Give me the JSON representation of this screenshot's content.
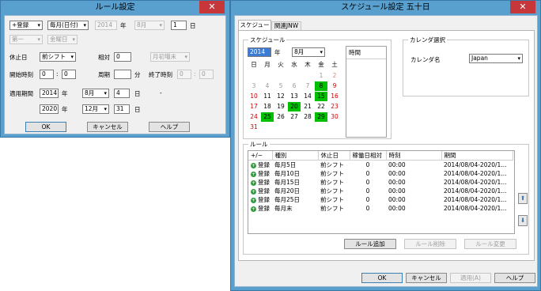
{
  "rule_dialog": {
    "title": "ルール設定",
    "close": "✕",
    "row1": {
      "mode": "+登録",
      "freq": "毎月(日付)",
      "year": "2014",
      "year_label": "年",
      "month": "8月",
      "day": "1",
      "day_label": "日"
    },
    "row2": {
      "week": "第一",
      "weekday": "金曜日"
    },
    "holiday_label": "休止日",
    "holiday": "前シフト",
    "relative_label": "相対",
    "relative": "0",
    "monthend": "月初増末",
    "start_label": "開始時刻",
    "start_h": "0",
    "start_m": "0",
    "cycle_label": "周期",
    "cycle_unit": "分",
    "end_label": "終了時刻",
    "end_h": "0",
    "end_m": "0",
    "period_label": "適用期間",
    "from": {
      "year": "2014",
      "year_label": "年",
      "month": "8月",
      "day": "4",
      "day_label": "日"
    },
    "dash": "-",
    "to": {
      "year": "2020",
      "year_label": "年",
      "month": "12月",
      "day": "31",
      "day_label": "日"
    },
    "ok": "OK",
    "cancel": "キャンセル",
    "help": "ヘルプ"
  },
  "schedule_dialog": {
    "title": "スケジュール設定 五十日",
    "close": "✕",
    "tabs": [
      "スケジュール",
      "関連JNW"
    ],
    "schedule_group": "スケジュール",
    "year": "2014",
    "year_label": "年",
    "month": "8月",
    "weekdays": [
      "日",
      "月",
      "火",
      "水",
      "木",
      "金",
      "土"
    ],
    "time_header": "時間",
    "calendar_group": "カレンダ選択",
    "calendar_name_label": "カレンダ名",
    "calendar_name": "Japan",
    "rule_group": "ルール",
    "rule_columns": [
      "+/−",
      "種別",
      "休止日",
      "稼働日相対",
      "時刻",
      "期間"
    ],
    "rules": [
      {
        "op": "登録",
        "type": "毎月5日",
        "holiday": "前シフト",
        "rel": "0",
        "time": "00:00",
        "period": "2014/08/04-2020/1..."
      },
      {
        "op": "登録",
        "type": "毎月10日",
        "holiday": "前シフト",
        "rel": "0",
        "time": "00:00",
        "period": "2014/08/04-2020/1..."
      },
      {
        "op": "登録",
        "type": "毎月15日",
        "holiday": "前シフト",
        "rel": "0",
        "time": "00:00",
        "period": "2014/08/04-2020/1..."
      },
      {
        "op": "登録",
        "type": "毎月20日",
        "holiday": "前シフト",
        "rel": "0",
        "time": "00:00",
        "period": "2014/08/04-2020/1..."
      },
      {
        "op": "登録",
        "type": "毎月25日",
        "holiday": "前シフト",
        "rel": "0",
        "time": "00:00",
        "period": "2014/08/04-2020/1..."
      },
      {
        "op": "登録",
        "type": "毎月末",
        "holiday": "前シフト",
        "rel": "0",
        "time": "00:00",
        "period": "2014/08/04-2020/1..."
      }
    ],
    "add_rule": "ルール追加",
    "delete_rule": "ルール削除",
    "change_rule": "ルール変更",
    "ok": "OK",
    "cancel": "キャンセル",
    "apply": "適用(A)",
    "help": "ヘルプ"
  },
  "calendar": {
    "cells": [
      {
        "d": "",
        "c": ""
      },
      {
        "d": "",
        "c": ""
      },
      {
        "d": "",
        "c": ""
      },
      {
        "d": "",
        "c": ""
      },
      {
        "d": "",
        "c": ""
      },
      {
        "d": "1",
        "c": "gray"
      },
      {
        "d": "2",
        "c": "grayred"
      },
      {
        "d": "3",
        "c": "gray"
      },
      {
        "d": "4",
        "c": "gray"
      },
      {
        "d": "5",
        "c": "gray"
      },
      {
        "d": "6",
        "c": "gray"
      },
      {
        "d": "7",
        "c": "gray"
      },
      {
        "d": "8",
        "c": "hl"
      },
      {
        "d": "9",
        "c": "red"
      },
      {
        "d": "10",
        "c": "red"
      },
      {
        "d": "11",
        "c": ""
      },
      {
        "d": "12",
        "c": ""
      },
      {
        "d": "13",
        "c": ""
      },
      {
        "d": "14",
        "c": ""
      },
      {
        "d": "15",
        "c": "hl"
      },
      {
        "d": "16",
        "c": "red"
      },
      {
        "d": "17",
        "c": "red"
      },
      {
        "d": "18",
        "c": ""
      },
      {
        "d": "19",
        "c": ""
      },
      {
        "d": "20",
        "c": "hl"
      },
      {
        "d": "21",
        "c": ""
      },
      {
        "d": "22",
        "c": ""
      },
      {
        "d": "23",
        "c": "red"
      },
      {
        "d": "24",
        "c": "red"
      },
      {
        "d": "25",
        "c": "hl"
      },
      {
        "d": "26",
        "c": ""
      },
      {
        "d": "27",
        "c": ""
      },
      {
        "d": "28",
        "c": ""
      },
      {
        "d": "29",
        "c": "hl"
      },
      {
        "d": "30",
        "c": "red"
      },
      {
        "d": "31",
        "c": "red"
      },
      {
        "d": "",
        "c": ""
      },
      {
        "d": "",
        "c": ""
      },
      {
        "d": "",
        "c": ""
      },
      {
        "d": "",
        "c": ""
      },
      {
        "d": "",
        "c": ""
      },
      {
        "d": "",
        "c": ""
      }
    ]
  }
}
